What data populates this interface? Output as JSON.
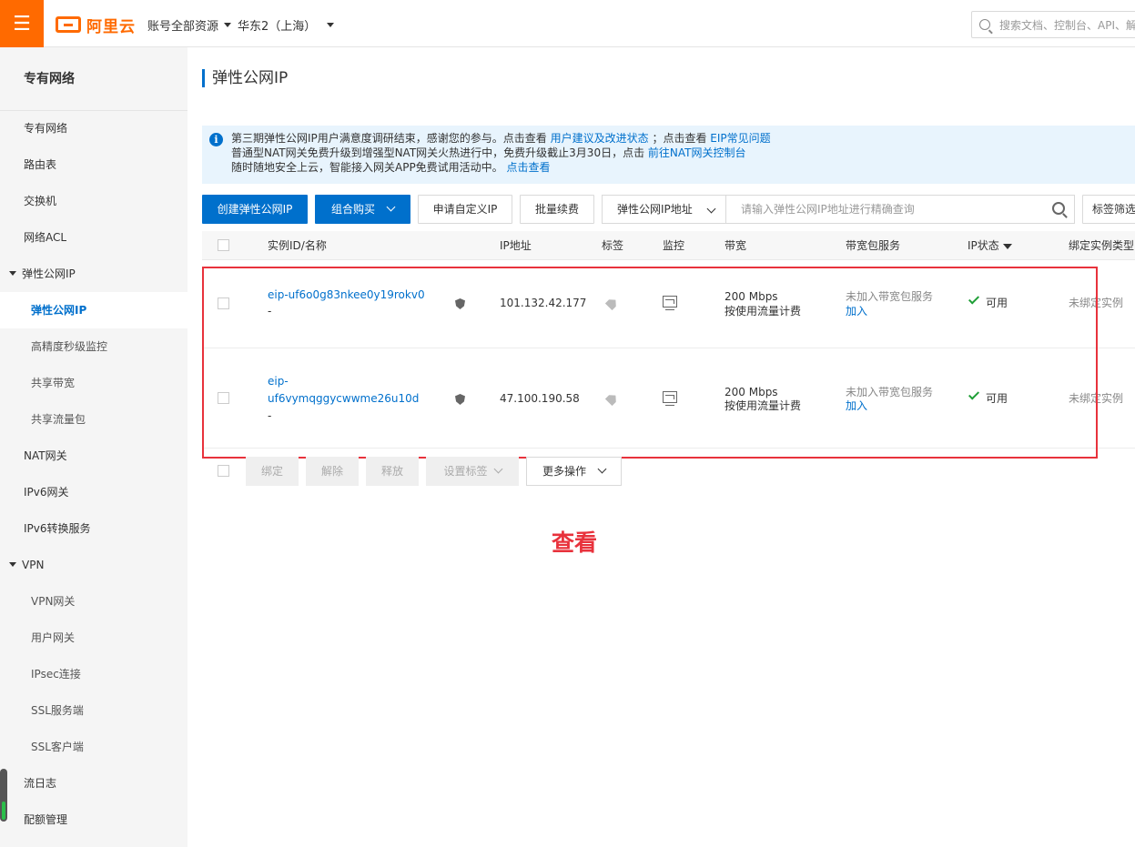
{
  "header": {
    "menu_icon": "☰",
    "logo_text": "阿里云",
    "account_dropdown": "账号全部资源",
    "region_dropdown": "华东2（上海）",
    "search_placeholder": "搜索文档、控制台、API、解"
  },
  "sidebar": {
    "title": "专有网络",
    "items": [
      {
        "label": "专有网络"
      },
      {
        "label": "路由表"
      },
      {
        "label": "交换机"
      },
      {
        "label": "网络ACL"
      },
      {
        "label": "弹性公网IP"
      },
      {
        "label": "弹性公网IP"
      },
      {
        "label": "高精度秒级监控"
      },
      {
        "label": "共享带宽"
      },
      {
        "label": "共享流量包"
      },
      {
        "label": "NAT网关"
      },
      {
        "label": "IPv6网关"
      },
      {
        "label": "IPv6转换服务"
      },
      {
        "label": "VPN"
      },
      {
        "label": "VPN网关"
      },
      {
        "label": "用户网关"
      },
      {
        "label": "IPsec连接"
      },
      {
        "label": "SSL服务端"
      },
      {
        "label": "SSL客户端"
      },
      {
        "label": "流日志"
      },
      {
        "label": "配额管理"
      }
    ]
  },
  "main": {
    "title": "弹性公网IP",
    "notice": {
      "line1_text": "第三期弹性公网IP用户满意度调研结束，感谢您的参与。点击查看",
      "line1_link1": "用户建议及改进状态",
      "line1_mid": "；点击查看",
      "line1_link2": "EIP常见问题",
      "line2_text": "普通型NAT网关免费升级到增强型NAT网关火热进行中，免费升级截止3月30日，点击",
      "line2_link": "前往NAT网关控制台",
      "line3_text": "随时随地安全上云，智能接入网关APP免费试用活动中。",
      "line3_link": "点击查看"
    },
    "toolbar": {
      "create": "创建弹性公网IP",
      "combo_buy": "组合购买",
      "apply_custom": "申请自定义IP",
      "batch_renew": "批量续费",
      "filter_select": "弹性公网IP地址",
      "filter_placeholder": "请输入弹性公网IP地址进行精确查询",
      "tag_filter": "标签筛选"
    },
    "table": {
      "columns": [
        "实例ID/名称",
        "IP地址",
        "标签",
        "监控",
        "带宽",
        "带宽包服务",
        "IP状态",
        "绑定实例类型"
      ],
      "rows": [
        {
          "id_line1": "eip-uf6o0g83nkee0y19rokv0",
          "id_line2": "",
          "name": "-",
          "ip": "101.132.42.177",
          "bandwidth": "200 Mbps",
          "billing": "按使用流量计费",
          "pkg_status": "未加入带宽包服务",
          "pkg_action": "加入",
          "status": "可用",
          "bind_type": "未绑定实例"
        },
        {
          "id_line1": "eip-",
          "id_line2": "uf6vymqggycwwme26u10d",
          "name": "-",
          "ip": "47.100.190.58",
          "bandwidth": "200 Mbps",
          "billing": "按使用流量计费",
          "pkg_status": "未加入带宽包服务",
          "pkg_action": "加入",
          "status": "可用",
          "bind_type": "未绑定实例"
        }
      ]
    },
    "bulk": {
      "bind": "绑定",
      "unbind": "解除",
      "release": "释放",
      "set_tag": "设置标签",
      "more": "更多操作"
    },
    "annotation": "查看"
  },
  "colors": {
    "brand": "#ff6a00",
    "primary": "#0070cc",
    "highlight": "#e8323c",
    "ok": "#1e9e36"
  }
}
